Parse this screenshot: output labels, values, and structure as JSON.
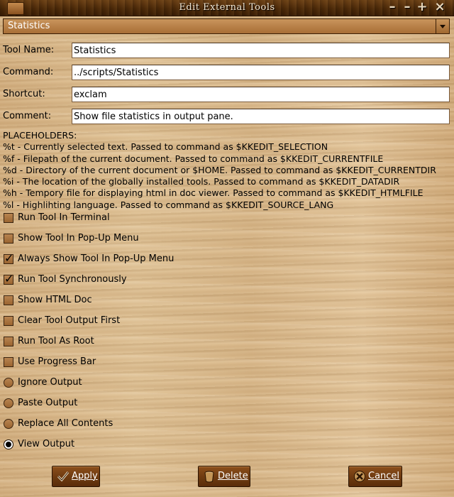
{
  "window": {
    "title": "Edit External Tools"
  },
  "tool_select": {
    "selected": "Statistics"
  },
  "form": {
    "tool_name": {
      "label": "Tool Name:",
      "value": "Statistics"
    },
    "command": {
      "label": "Command:",
      "value": "../scripts/Statistics"
    },
    "shortcut": {
      "label": "Shortcut:",
      "value": "exclam"
    },
    "comment": {
      "label": "Comment:",
      "value": "Show file statistics in output pane."
    }
  },
  "placeholders": {
    "heading": "PLACEHOLDERS:",
    "lines": [
      "%t - Currently selected text. Passed to command as $KKEDIT_SELECTION",
      "%f - Filepath of the current document. Passed to command as $KKEDIT_CURRENTFILE",
      "%d - Directory of the current document or $HOME. Passed to command as $KKEDIT_CURRENTDIR",
      "%i - The location of the globally installed tools. Passed to command as $KKEDIT_DATADIR",
      "%h - Tempory file for displaying html in doc viewer. Passed to command as $KKEDIT_HTMLFILE",
      "%l - Highlihting language. Passed to command as $KKEDIT_SOURCE_LANG"
    ]
  },
  "options": {
    "checkboxes": [
      {
        "label": "Run Tool In Terminal",
        "checked": false
      },
      {
        "label": "Show Tool In Pop-Up Menu",
        "checked": false
      },
      {
        "label": "Always Show Tool In Pop-Up Menu",
        "checked": true
      },
      {
        "label": "Run Tool Synchronously",
        "checked": true
      },
      {
        "label": "Show HTML Doc",
        "checked": false
      },
      {
        "label": "Clear Tool Output First",
        "checked": false
      },
      {
        "label": "Run Tool As Root",
        "checked": false
      },
      {
        "label": "Use Progress Bar",
        "checked": false
      }
    ],
    "radios": [
      {
        "label": "Ignore Output",
        "selected": false
      },
      {
        "label": "Paste Output",
        "selected": false
      },
      {
        "label": "Replace All Contents",
        "selected": false
      },
      {
        "label": "View Output",
        "selected": true
      }
    ]
  },
  "buttons": {
    "apply": {
      "label": "Apply",
      "icon": "checkmark-icon"
    },
    "delete": {
      "label": "Delete",
      "icon": "trash-icon"
    },
    "cancel": {
      "label": "Cancel",
      "icon": "cancel-icon"
    }
  },
  "colors": {
    "accent": "#6d3a10",
    "titlebar": "#4a2808"
  }
}
